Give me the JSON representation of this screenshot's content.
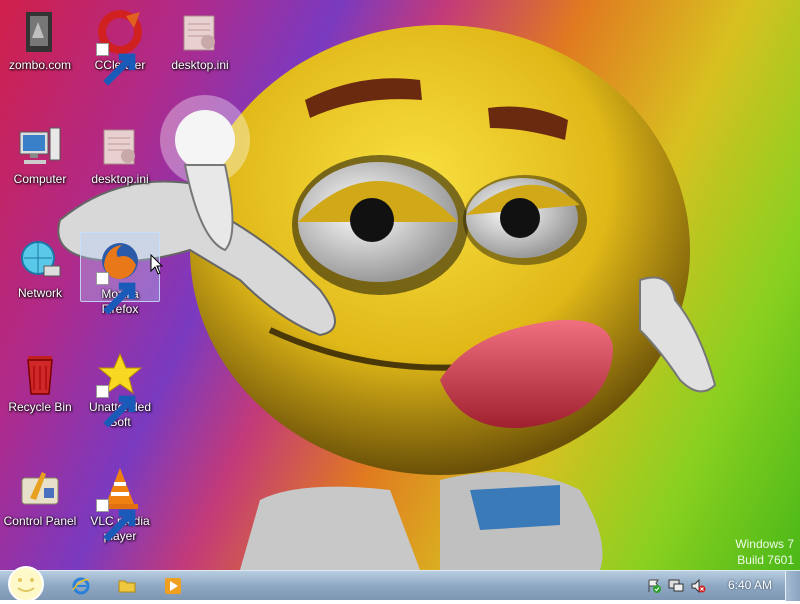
{
  "desktop": {
    "icons": [
      {
        "label": "zombo.com"
      },
      {
        "label": "CCleaner"
      },
      {
        "label": "desktop.ini"
      },
      {
        "label": "Computer"
      },
      {
        "label": "desktop.ini"
      },
      {
        "label": "Network"
      },
      {
        "label": "Mozilla Firefox"
      },
      {
        "label": "Recycle Bin"
      },
      {
        "label": "Unattended Soft"
      },
      {
        "label": "Control Panel"
      },
      {
        "label": "VLC media player"
      }
    ],
    "watermark": {
      "line1": "Windows 7",
      "line2": "Build 7601"
    }
  },
  "taskbar": {
    "clock": "6:40 AM",
    "pinned": [
      "ie-icon",
      "explorer-folder-icon",
      "media-player-icon"
    ]
  },
  "colors": {
    "taskbar": "#8fa9c4",
    "selection": "#b4d2ff"
  }
}
